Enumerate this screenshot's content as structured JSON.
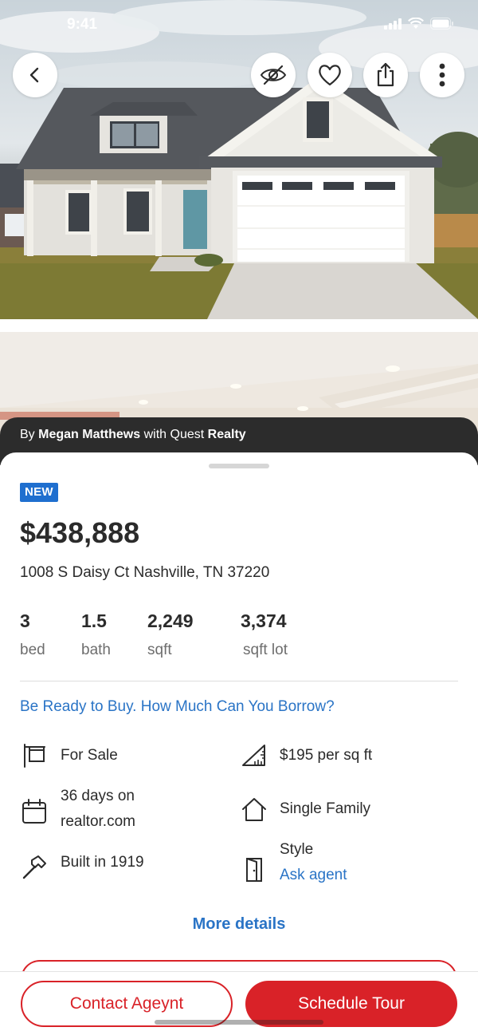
{
  "status": {
    "time": "9:41"
  },
  "agent": {
    "prefix": "By",
    "name": "Megan Matthews",
    "with": "with",
    "brokerage_light": "Quest",
    "brokerage_bold": "Realty"
  },
  "listing": {
    "badge": "NEW",
    "price": "$438,888",
    "address": "1008 S Daisy Ct Nashville, TN 37220",
    "stats": [
      {
        "value": "3",
        "label": "bed"
      },
      {
        "value": "1.5",
        "label": "bath"
      },
      {
        "value": "2,249",
        "label": "sqft"
      },
      {
        "value": "3,374",
        "label": "sqft lot"
      }
    ],
    "borrow_link": "Be Ready to Buy. How Much Can You Borrow?",
    "features": {
      "status": "For Sale",
      "price_per_sqft": "$195 per sq ft",
      "days_line1": "36 days on",
      "days_line2": "realtor.com",
      "property_type": "Single Family",
      "built": "Built in 1919",
      "style_label": "Style",
      "style_link": "Ask agent"
    },
    "more_details": "More details"
  },
  "actions": {
    "contact": "Contact Ageynt",
    "schedule": "Schedule Tour"
  },
  "icons": {
    "back": "chevron-left-icon",
    "hide": "eye-off-icon",
    "favorite": "heart-icon",
    "share": "share-icon",
    "more": "more-vertical-icon",
    "signal": "signal-icon",
    "wifi": "wifi-icon",
    "battery": "battery-icon",
    "sign": "for-sale-sign-icon",
    "ruler": "ruler-icon",
    "calendar": "calendar-icon",
    "house": "house-icon",
    "hammer": "hammer-icon",
    "door": "door-icon"
  },
  "colors": {
    "accent_red": "#d92228",
    "link_blue": "#2a74c6",
    "badge_blue": "#1f6fcf",
    "strip_dark": "#2c2c2c"
  }
}
